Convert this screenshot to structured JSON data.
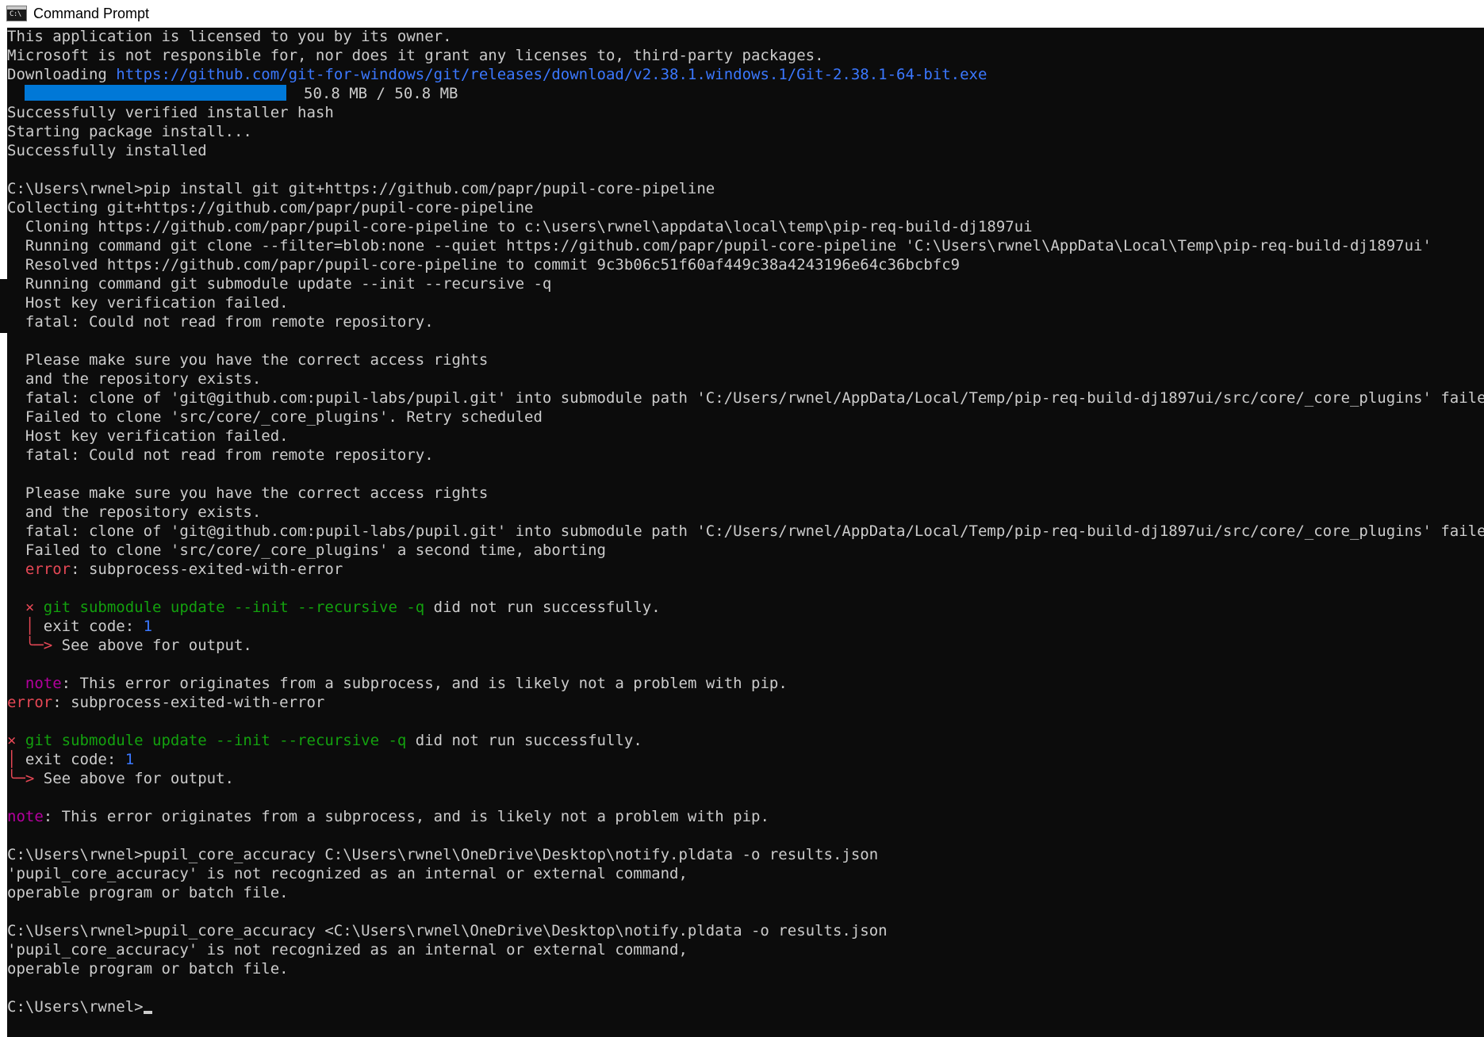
{
  "window": {
    "title": "Command Prompt",
    "icon": "cmd-console-icon",
    "icon_text": "C:\\"
  },
  "download": {
    "prefix": "Downloading ",
    "url": "https://github.com/git-for-windows/git/releases/download/v2.38.1.windows.1/Git-2.38.1-64-bit.exe",
    "progress_fraction": 1.0,
    "size_text": "50.8 MB / 50.8 MB"
  },
  "lines": {
    "l1": "This application is licensed to you by its owner.",
    "l2": "Microsoft is not responsible for, nor does it grant any licenses to, third-party packages.",
    "l5": "Successfully verified installer hash",
    "l6": "Starting package install...",
    "l7": "Successfully installed",
    "l9": "C:\\Users\\rwnel>pip install git git+https://github.com/papr/pupil-core-pipeline",
    "l10": "Collecting git+https://github.com/papr/pupil-core-pipeline",
    "l11": "  Cloning https://github.com/papr/pupil-core-pipeline to c:\\users\\rwnel\\appdata\\local\\temp\\pip-req-build-dj1897ui",
    "l12": "  Running command git clone --filter=blob:none --quiet https://github.com/papr/pupil-core-pipeline 'C:\\Users\\rwnel\\AppData\\Local\\Temp\\pip-req-build-dj1897ui'",
    "l13": "  Resolved https://github.com/papr/pupil-core-pipeline to commit 9c3b06c51f60af449c38a4243196e64c36bcbfc9",
    "l14": "  Running command git submodule update --init --recursive -q",
    "l15": "  Host key verification failed.",
    "l16": "  fatal: Could not read from remote repository.",
    "l18": "  Please make sure you have the correct access rights",
    "l19": "  and the repository exists.",
    "l20": "  fatal: clone of 'git@github.com:pupil-labs/pupil.git' into submodule path 'C:/Users/rwnel/AppData/Local/Temp/pip-req-build-dj1897ui/src/core/_core_plugins' failed",
    "l21": "  Failed to clone 'src/core/_core_plugins'. Retry scheduled",
    "l22": "  Host key verification failed.",
    "l23": "  fatal: Could not read from remote repository.",
    "l25": "  Please make sure you have the correct access rights",
    "l26": "  and the repository exists.",
    "l27": "  fatal: clone of 'git@github.com:pupil-labs/pupil.git' into submodule path 'C:/Users/rwnel/AppData/Local/Temp/pip-req-build-dj1897ui/src/core/_core_plugins' failed",
    "l28": "  Failed to clone 'src/core/_core_plugins' a second time, aborting",
    "l45": "C:\\Users\\rwnel>pupil_core_accuracy C:\\Users\\rwnel\\OneDrive\\Desktop\\notify.pldata -o results.json",
    "l46": "'pupil_core_accuracy' is not recognized as an internal or external command,",
    "l47": "operable program or batch file.",
    "l49": "C:\\Users\\rwnel>pupil_core_accuracy <C:\\Users\\rwnel\\OneDrive\\Desktop\\notify.pldata -o results.json",
    "l50": "'pupil_core_accuracy' is not recognized as an internal or external command,",
    "l51": "operable program or batch file.",
    "l53": "C:\\Users\\rwnel>"
  },
  "inner_error": {
    "error_label": "error",
    "error_msg": ": subprocess-exited-with-error",
    "x_mark": "×",
    "cmd": " git submodule update --init --recursive -q",
    "not_success": " did not run successfully.",
    "branch1": "│",
    "exit_label": " exit code: ",
    "exit_code": "1",
    "branch2": "╰─>",
    "see_above": " See above for output.",
    "note_label": "note",
    "note_msg": ": This error originates from a subprocess, and is likely not a problem with pip."
  },
  "outer_error": {
    "error_label": "error",
    "error_msg": ": subprocess-exited-with-error",
    "x_mark": "×",
    "cmd": " git submodule update --init --recursive -q",
    "not_success": " did not run successfully.",
    "branch1": "│",
    "exit_label": " exit code: ",
    "exit_code": "1",
    "branch2": "╰─>",
    "see_above": " See above for output.",
    "note_label": "note",
    "note_msg": ": This error originates from a subprocess, and is likely not a problem with pip."
  },
  "colors": {
    "background": "#0c0c0c",
    "text": "#cccccc",
    "link": "#3b78ff",
    "green": "#13a10e",
    "red": "#e74856",
    "magenta": "#b4009e",
    "progress": "#0078d7"
  }
}
